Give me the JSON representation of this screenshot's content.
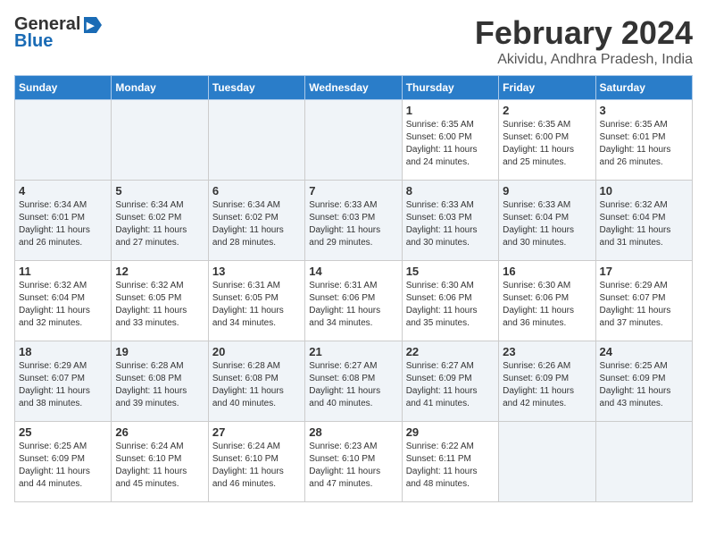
{
  "header": {
    "logo_general": "General",
    "logo_blue": "Blue",
    "month_title": "February 2024",
    "location": "Akividu, Andhra Pradesh, India"
  },
  "days_of_week": [
    "Sunday",
    "Monday",
    "Tuesday",
    "Wednesday",
    "Thursday",
    "Friday",
    "Saturday"
  ],
  "weeks": [
    [
      {
        "day": "",
        "info": ""
      },
      {
        "day": "",
        "info": ""
      },
      {
        "day": "",
        "info": ""
      },
      {
        "day": "",
        "info": ""
      },
      {
        "day": "1",
        "info": "Sunrise: 6:35 AM\nSunset: 6:00 PM\nDaylight: 11 hours\nand 24 minutes."
      },
      {
        "day": "2",
        "info": "Sunrise: 6:35 AM\nSunset: 6:00 PM\nDaylight: 11 hours\nand 25 minutes."
      },
      {
        "day": "3",
        "info": "Sunrise: 6:35 AM\nSunset: 6:01 PM\nDaylight: 11 hours\nand 26 minutes."
      }
    ],
    [
      {
        "day": "4",
        "info": "Sunrise: 6:34 AM\nSunset: 6:01 PM\nDaylight: 11 hours\nand 26 minutes."
      },
      {
        "day": "5",
        "info": "Sunrise: 6:34 AM\nSunset: 6:02 PM\nDaylight: 11 hours\nand 27 minutes."
      },
      {
        "day": "6",
        "info": "Sunrise: 6:34 AM\nSunset: 6:02 PM\nDaylight: 11 hours\nand 28 minutes."
      },
      {
        "day": "7",
        "info": "Sunrise: 6:33 AM\nSunset: 6:03 PM\nDaylight: 11 hours\nand 29 minutes."
      },
      {
        "day": "8",
        "info": "Sunrise: 6:33 AM\nSunset: 6:03 PM\nDaylight: 11 hours\nand 30 minutes."
      },
      {
        "day": "9",
        "info": "Sunrise: 6:33 AM\nSunset: 6:04 PM\nDaylight: 11 hours\nand 30 minutes."
      },
      {
        "day": "10",
        "info": "Sunrise: 6:32 AM\nSunset: 6:04 PM\nDaylight: 11 hours\nand 31 minutes."
      }
    ],
    [
      {
        "day": "11",
        "info": "Sunrise: 6:32 AM\nSunset: 6:04 PM\nDaylight: 11 hours\nand 32 minutes."
      },
      {
        "day": "12",
        "info": "Sunrise: 6:32 AM\nSunset: 6:05 PM\nDaylight: 11 hours\nand 33 minutes."
      },
      {
        "day": "13",
        "info": "Sunrise: 6:31 AM\nSunset: 6:05 PM\nDaylight: 11 hours\nand 34 minutes."
      },
      {
        "day": "14",
        "info": "Sunrise: 6:31 AM\nSunset: 6:06 PM\nDaylight: 11 hours\nand 34 minutes."
      },
      {
        "day": "15",
        "info": "Sunrise: 6:30 AM\nSunset: 6:06 PM\nDaylight: 11 hours\nand 35 minutes."
      },
      {
        "day": "16",
        "info": "Sunrise: 6:30 AM\nSunset: 6:06 PM\nDaylight: 11 hours\nand 36 minutes."
      },
      {
        "day": "17",
        "info": "Sunrise: 6:29 AM\nSunset: 6:07 PM\nDaylight: 11 hours\nand 37 minutes."
      }
    ],
    [
      {
        "day": "18",
        "info": "Sunrise: 6:29 AM\nSunset: 6:07 PM\nDaylight: 11 hours\nand 38 minutes."
      },
      {
        "day": "19",
        "info": "Sunrise: 6:28 AM\nSunset: 6:08 PM\nDaylight: 11 hours\nand 39 minutes."
      },
      {
        "day": "20",
        "info": "Sunrise: 6:28 AM\nSunset: 6:08 PM\nDaylight: 11 hours\nand 40 minutes."
      },
      {
        "day": "21",
        "info": "Sunrise: 6:27 AM\nSunset: 6:08 PM\nDaylight: 11 hours\nand 40 minutes."
      },
      {
        "day": "22",
        "info": "Sunrise: 6:27 AM\nSunset: 6:09 PM\nDaylight: 11 hours\nand 41 minutes."
      },
      {
        "day": "23",
        "info": "Sunrise: 6:26 AM\nSunset: 6:09 PM\nDaylight: 11 hours\nand 42 minutes."
      },
      {
        "day": "24",
        "info": "Sunrise: 6:25 AM\nSunset: 6:09 PM\nDaylight: 11 hours\nand 43 minutes."
      }
    ],
    [
      {
        "day": "25",
        "info": "Sunrise: 6:25 AM\nSunset: 6:09 PM\nDaylight: 11 hours\nand 44 minutes."
      },
      {
        "day": "26",
        "info": "Sunrise: 6:24 AM\nSunset: 6:10 PM\nDaylight: 11 hours\nand 45 minutes."
      },
      {
        "day": "27",
        "info": "Sunrise: 6:24 AM\nSunset: 6:10 PM\nDaylight: 11 hours\nand 46 minutes."
      },
      {
        "day": "28",
        "info": "Sunrise: 6:23 AM\nSunset: 6:10 PM\nDaylight: 11 hours\nand 47 minutes."
      },
      {
        "day": "29",
        "info": "Sunrise: 6:22 AM\nSunset: 6:11 PM\nDaylight: 11 hours\nand 48 minutes."
      },
      {
        "day": "",
        "info": ""
      },
      {
        "day": "",
        "info": ""
      }
    ]
  ]
}
